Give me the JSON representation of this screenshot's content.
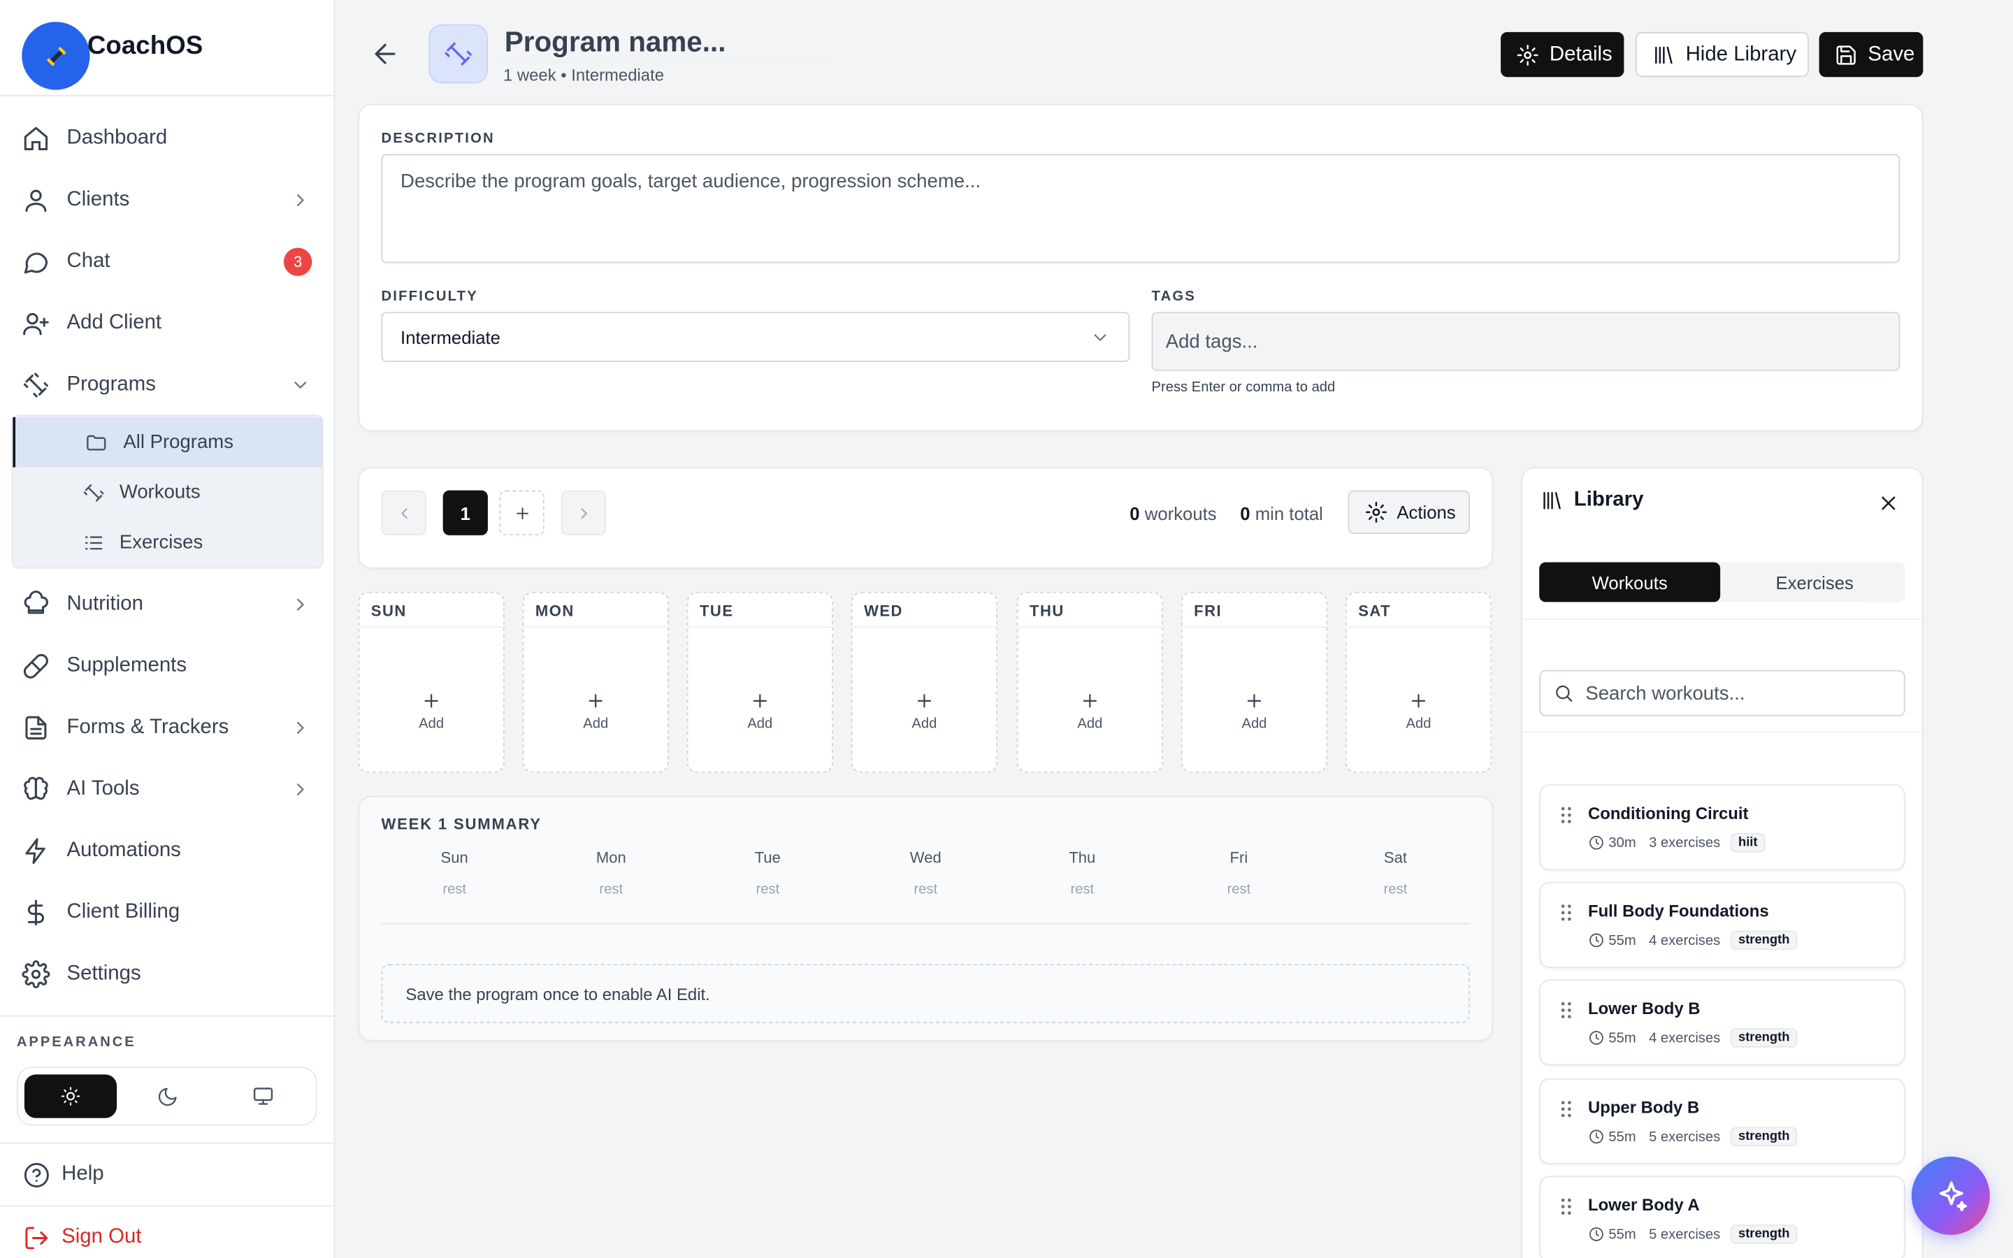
{
  "brand": {
    "name": "CoachOS",
    "logo_icon": "dumbbell-icon"
  },
  "sidebar": {
    "items": [
      {
        "label": "Dashboard",
        "icon": "home-icon"
      },
      {
        "label": "Clients",
        "icon": "user-icon"
      },
      {
        "label": "Chat",
        "icon": "chat-icon",
        "badge": "3"
      },
      {
        "label": "Add Client",
        "icon": "user-plus-icon"
      },
      {
        "label": "Programs",
        "icon": "dumbbell-icon"
      },
      {
        "label": "Nutrition",
        "icon": "chef-hat-icon"
      },
      {
        "label": "Supplements",
        "icon": "pill-icon"
      },
      {
        "label": "Forms & Trackers",
        "icon": "file-icon"
      },
      {
        "label": "AI Tools",
        "icon": "brain-icon"
      },
      {
        "label": "Automations",
        "icon": "bolt-icon"
      },
      {
        "label": "Client Billing",
        "icon": "dollar-icon"
      },
      {
        "label": "Settings",
        "icon": "gear-icon"
      }
    ],
    "programs_sub": [
      {
        "label": "All Programs",
        "icon": "folder-icon"
      },
      {
        "label": "Workouts",
        "icon": "dumbbell-icon"
      },
      {
        "label": "Exercises",
        "icon": "list-icon"
      }
    ],
    "appearance_label": "APPEARANCE",
    "help": "Help",
    "sign_out": "Sign Out"
  },
  "header": {
    "program_name_placeholder": "Program name...",
    "meta": "1 week • Intermediate",
    "details_label": "Details",
    "hide_library_label": "Hide Library",
    "save_label": "Save"
  },
  "details": {
    "description_label": "DESCRIPTION",
    "description_placeholder": "Describe the program goals, target audience, progression scheme...",
    "difficulty_label": "DIFFICULTY",
    "difficulty_value": "Intermediate",
    "tags_label": "TAGS",
    "tags_placeholder": "Add tags...",
    "tags_hint": "Press Enter or comma to add"
  },
  "week_nav": {
    "current_week": "1",
    "workouts_count": "0",
    "workouts_label": "workouts",
    "minutes_count": "0",
    "minutes_label": "min total",
    "actions_label": "Actions"
  },
  "days": [
    {
      "name": "SUN",
      "add": "Add"
    },
    {
      "name": "MON",
      "add": "Add"
    },
    {
      "name": "TUE",
      "add": "Add"
    },
    {
      "name": "WED",
      "add": "Add"
    },
    {
      "name": "THU",
      "add": "Add"
    },
    {
      "name": "FRI",
      "add": "Add"
    },
    {
      "name": "SAT",
      "add": "Add"
    }
  ],
  "summary": {
    "title": "WEEK 1 SUMMARY",
    "days": [
      {
        "day": "Sun",
        "status": "rest"
      },
      {
        "day": "Mon",
        "status": "rest"
      },
      {
        "day": "Tue",
        "status": "rest"
      },
      {
        "day": "Wed",
        "status": "rest"
      },
      {
        "day": "Thu",
        "status": "rest"
      },
      {
        "day": "Fri",
        "status": "rest"
      },
      {
        "day": "Sat",
        "status": "rest"
      }
    ],
    "ai_note": "Save the program once to enable AI Edit."
  },
  "library": {
    "title": "Library",
    "tabs": [
      "Workouts",
      "Exercises"
    ],
    "active_tab": "Workouts",
    "search_placeholder": "Search workouts...",
    "workouts": [
      {
        "name": "Conditioning Circuit",
        "duration": "30m",
        "exercises": "3 exercises",
        "tag": "hiit"
      },
      {
        "name": "Full Body Foundations",
        "duration": "55m",
        "exercises": "4 exercises",
        "tag": "strength"
      },
      {
        "name": "Lower Body B",
        "duration": "55m",
        "exercises": "4 exercises",
        "tag": "strength"
      },
      {
        "name": "Upper Body B",
        "duration": "55m",
        "exercises": "5 exercises",
        "tag": "strength"
      },
      {
        "name": "Lower Body A",
        "duration": "55m",
        "exercises": "5 exercises",
        "tag": "strength"
      }
    ]
  },
  "colors": {
    "accent": "#111111",
    "brand": "#2563eb",
    "badge": "#ef4444",
    "danger": "#dc2626"
  }
}
